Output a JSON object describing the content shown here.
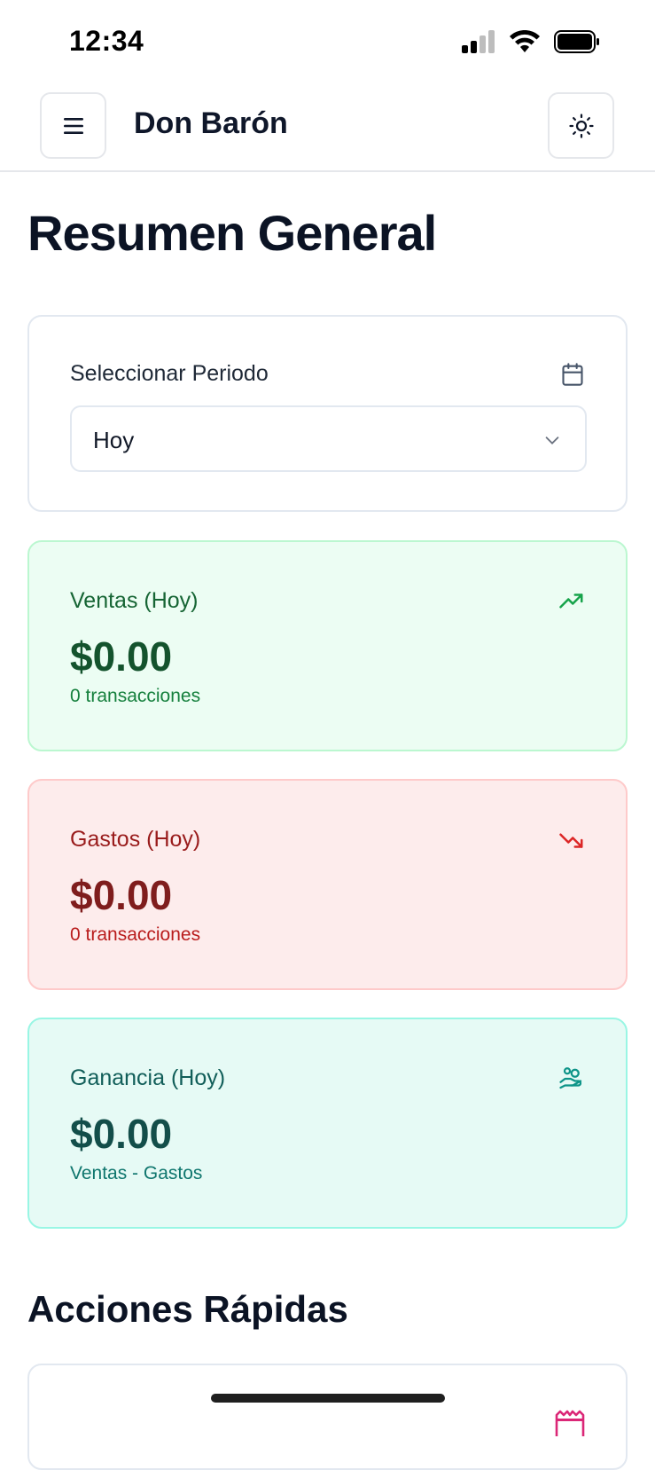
{
  "status_bar": {
    "time": "12:34"
  },
  "header": {
    "title": "Don Barón",
    "menu_icon": "hamburger-menu-icon",
    "theme_icon": "sun-icon"
  },
  "page": {
    "title": "Resumen General"
  },
  "period": {
    "label": "Seleccionar Periodo",
    "selected": "Hoy",
    "icon": "calendar-icon"
  },
  "stats": {
    "sales": {
      "label": "Ventas (Hoy)",
      "value": "$0.00",
      "sub": "0 transacciones",
      "icon": "trending-up-icon",
      "color": "#16a34a"
    },
    "expenses": {
      "label": "Gastos (Hoy)",
      "value": "$0.00",
      "sub": "0 transacciones",
      "icon": "trending-down-icon",
      "color": "#dc2626"
    },
    "profit": {
      "label": "Ganancia (Hoy)",
      "value": "$0.00",
      "sub": "Ventas - Gastos",
      "icon": "hand-coins-icon",
      "color": "#0d9488"
    }
  },
  "quick_actions": {
    "title": "Acciones Rápidas",
    "first_icon": "receipt-icon"
  }
}
